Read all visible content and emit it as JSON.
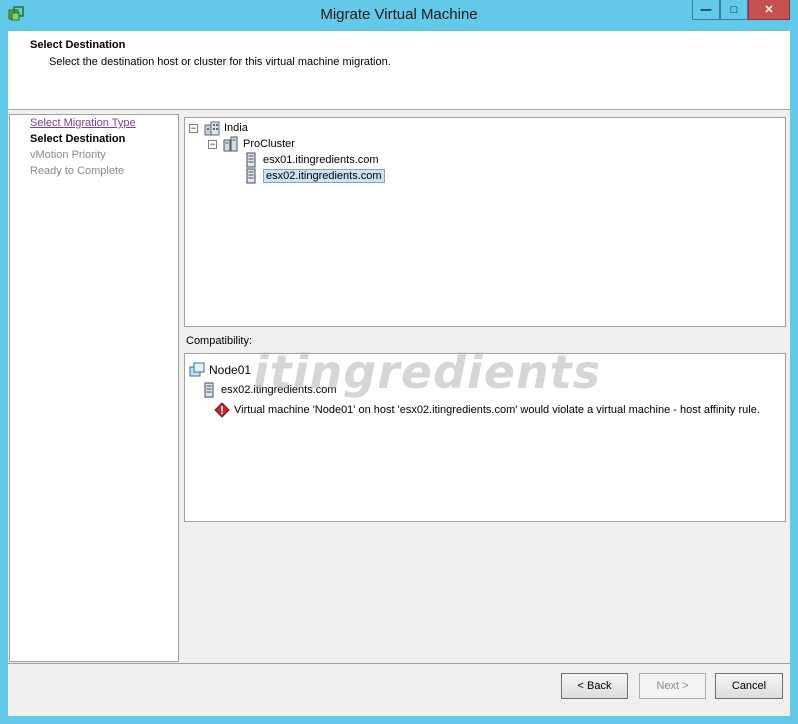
{
  "window": {
    "title": "Migrate Virtual Machine",
    "controls": {
      "minimize": "—",
      "maximize": "□",
      "close": "✕"
    }
  },
  "header": {
    "title": "Select Destination",
    "subtitle": "Select the destination host or cluster for this virtual machine migration."
  },
  "steps": [
    {
      "label": "Select Migration Type",
      "state": "link"
    },
    {
      "label": "Select Destination",
      "state": "current"
    },
    {
      "label": "vMotion Priority",
      "state": "disabled"
    },
    {
      "label": "Ready to Complete",
      "state": "disabled"
    }
  ],
  "tree": {
    "datacenter": {
      "label": "India",
      "icon": "datacenter-icon",
      "expander": "−"
    },
    "cluster": {
      "label": "ProCluster",
      "icon": "cluster-icon",
      "expander": "−"
    },
    "hosts": [
      {
        "label": "esx01.itingredients.com",
        "icon": "host-icon",
        "selected": false
      },
      {
        "label": "esx02.itingredients.com",
        "icon": "host-icon",
        "selected": true
      }
    ]
  },
  "compatibility": {
    "label": "Compatibility:",
    "vm": {
      "label": "Node01",
      "icon": "vm-icon"
    },
    "host": {
      "label": "esx02.itingredients.com",
      "icon": "host-icon"
    },
    "message": "Virtual machine 'Node01' on host 'esx02.itingredients.com' would violate a virtual machine - host affinity rule.",
    "message_icon": "error-icon"
  },
  "watermark": "itingredients",
  "buttons": {
    "back": "< Back",
    "next": "Next >",
    "cancel": "Cancel"
  },
  "colors": {
    "window_frame": "#62c9e8",
    "selection": "#cde4f7",
    "error": "#c0282d",
    "link": "#7a3fa3"
  }
}
